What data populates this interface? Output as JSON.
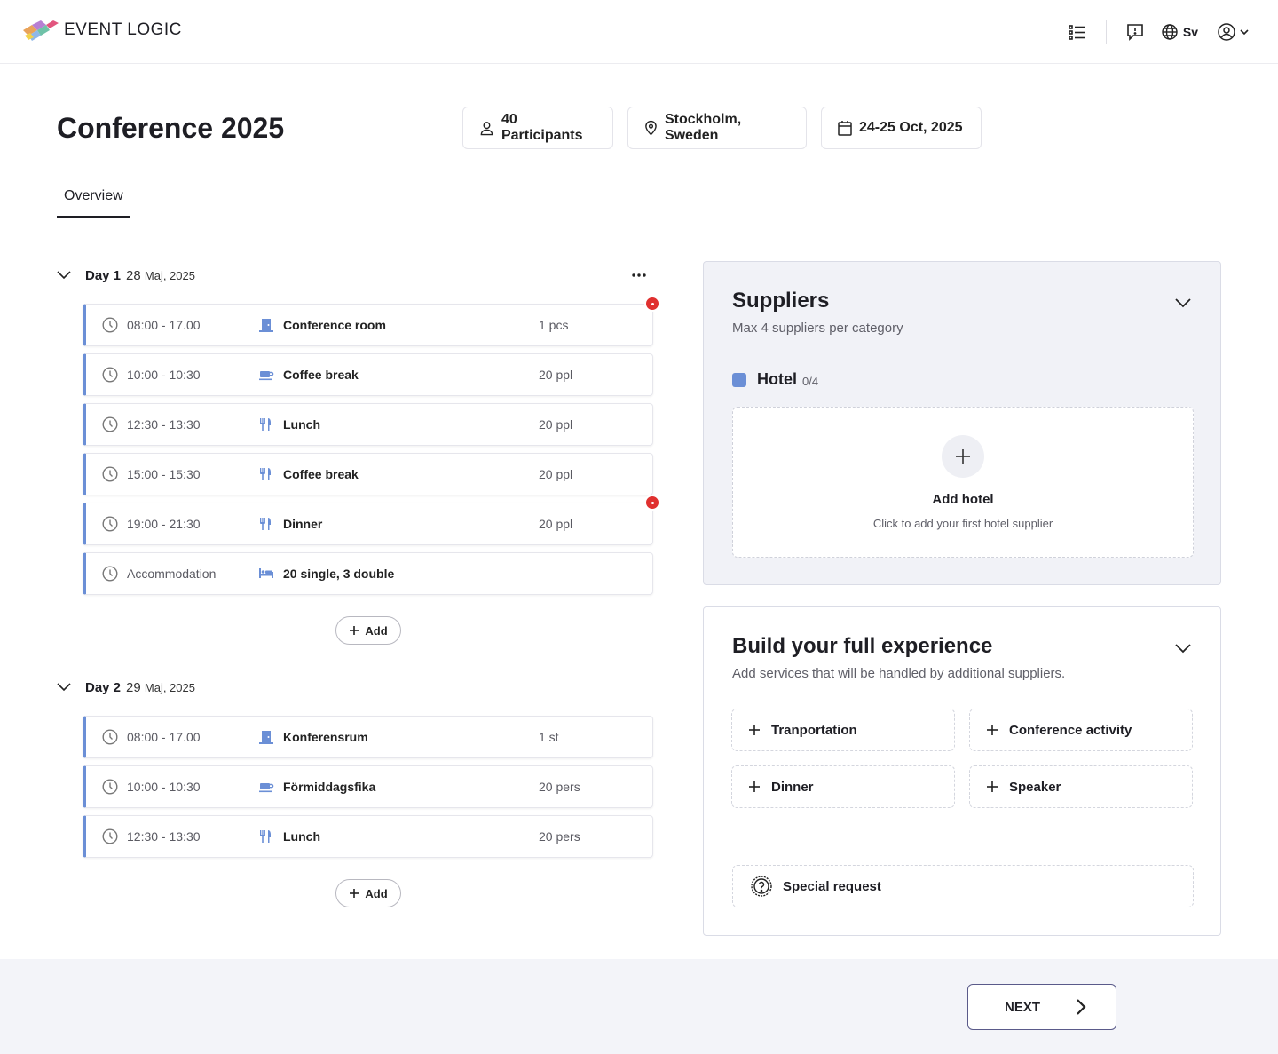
{
  "app": {
    "logo_text": "EVENT LOGIC",
    "language": "Sv"
  },
  "event": {
    "title": "Conference 2025",
    "participants": "40 Participants",
    "location": "Stockholm, Sweden",
    "dates": "24-25 Oct, 2025"
  },
  "tabs": [
    {
      "label": "Overview"
    }
  ],
  "days": [
    {
      "label": "Day 1",
      "date_num": "28",
      "date_rest": "Maj, 2025",
      "items": [
        {
          "time": "08:00 - 17.00",
          "icon": "door-icon",
          "name": "Conference room",
          "qty": "1 pcs"
        },
        {
          "time": "10:00 - 10:30",
          "icon": "coffee-icon",
          "name": "Coffee break",
          "qty": "20 ppl"
        },
        {
          "time": "12:30 - 13:30",
          "icon": "cutlery-icon",
          "name": "Lunch",
          "qty": "20 ppl"
        },
        {
          "time": "15:00 - 15:30",
          "icon": "cutlery-icon",
          "name": "Coffee break",
          "qty": "20 ppl"
        },
        {
          "time": "19:00 - 21:30",
          "icon": "cutlery-icon",
          "name": "Dinner",
          "qty": "20 ppl"
        },
        {
          "time": "Accommodation",
          "icon": "bed-icon",
          "name": "20 single, 3 double",
          "qty": ""
        }
      ],
      "add_label": "Add"
    },
    {
      "label": "Day 2",
      "date_num": "29",
      "date_rest": "Maj, 2025",
      "items": [
        {
          "time": "08:00 - 17.00",
          "icon": "door-icon",
          "name": "Konferensrum",
          "qty": "1 st"
        },
        {
          "time": "10:00 - 10:30",
          "icon": "coffee-icon",
          "name": "Förmiddagsfika",
          "qty": "20 pers"
        },
        {
          "time": "12:30 - 13:30",
          "icon": "cutlery-icon",
          "name": "Lunch",
          "qty": "20 pers"
        }
      ],
      "add_label": "Add"
    }
  ],
  "suppliers": {
    "title": "Suppliers",
    "subtitle": "Max 4 suppliers per category",
    "hotel_label": "Hotel",
    "hotel_count": "0/4",
    "add_title": "Add hotel",
    "add_subtitle": "Click to add your first hotel supplier"
  },
  "experience": {
    "title": "Build your full experience",
    "subtitle": "Add services that will be handled by additional suppliers.",
    "services": [
      "Tranportation",
      "Conference activity",
      "Dinner",
      "Speaker"
    ],
    "special_request": "Special request"
  },
  "footer": {
    "next_label": "NEXT"
  },
  "colors": {
    "accent": "#6b8fd6",
    "alert": "#e0302f",
    "card_bg": "#f1f2f7",
    "footer_bg": "#f3f4f9"
  }
}
